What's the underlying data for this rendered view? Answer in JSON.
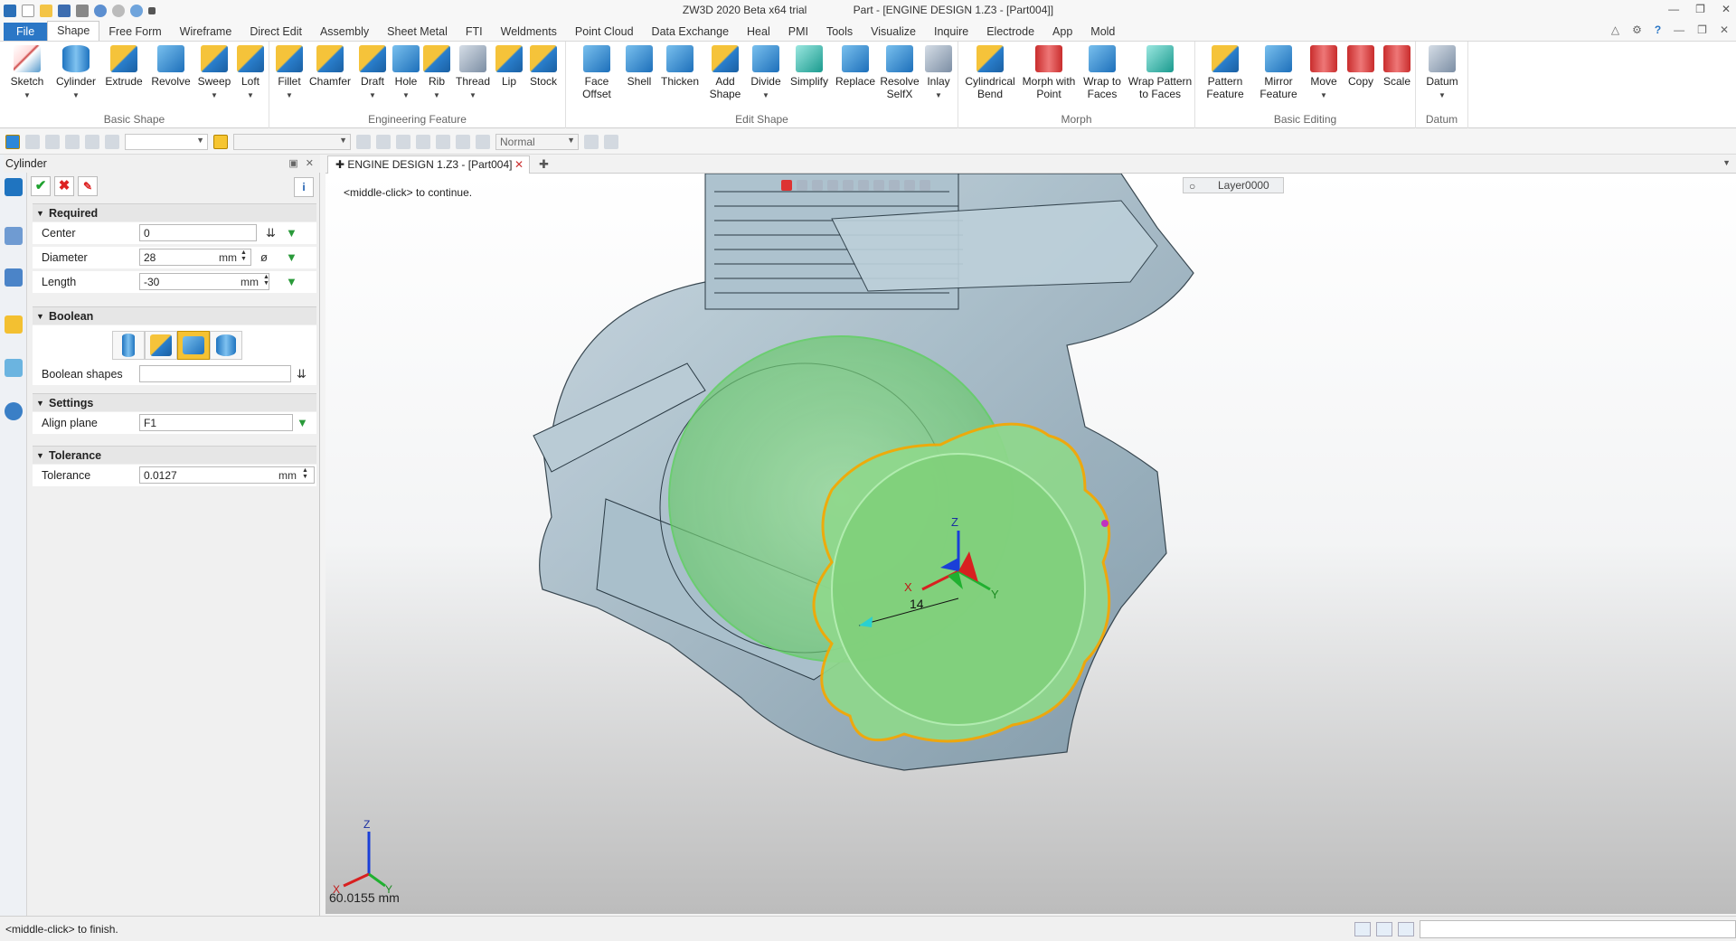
{
  "window": {
    "app_title": "ZW3D 2020 Beta x64 trial",
    "doc_title": "Part - [ENGINE DESIGN 1.Z3 - [Part004]]"
  },
  "menu": {
    "file": "File",
    "tabs": [
      "Shape",
      "Free Form",
      "Wireframe",
      "Direct Edit",
      "Assembly",
      "Sheet Metal",
      "FTI",
      "Weldments",
      "Point Cloud",
      "Data Exchange",
      "Heal",
      "PMI",
      "Tools",
      "Visualize",
      "Inquire",
      "Electrode",
      "App",
      "Mold"
    ]
  },
  "ribbon": {
    "basic_shape": {
      "label": "Basic Shape",
      "buttons": [
        "Sketch",
        "Cylinder",
        "Extrude",
        "Revolve",
        "Sweep",
        "Loft"
      ]
    },
    "engineering_feature": {
      "label": "Engineering Feature",
      "buttons": [
        "Fillet",
        "Chamfer",
        "Draft",
        "Hole",
        "Rib",
        "Thread",
        "Lip",
        "Stock"
      ]
    },
    "edit_shape": {
      "label": "Edit Shape",
      "buttons": [
        "Face Offset",
        "Shell",
        "Thicken",
        "Add Shape",
        "Divide",
        "Simplify",
        "Replace",
        "Resolve SelfX",
        "Inlay"
      ]
    },
    "morph": {
      "label": "Morph",
      "buttons": [
        "Cylindrical Bend",
        "Morph with Point",
        "Wrap to Faces",
        "Wrap Pattern to Faces"
      ]
    },
    "basic_editing": {
      "label": "Basic Editing",
      "buttons": [
        "Pattern Feature",
        "Mirror Feature",
        "Move",
        "Copy",
        "Scale"
      ]
    },
    "datum": {
      "label": "Datum",
      "buttons": [
        "Datum"
      ]
    }
  },
  "toolbar2": {
    "mode_combo": "Normal"
  },
  "panel": {
    "title": "Cylinder",
    "required": {
      "label": "Required",
      "center": {
        "label": "Center",
        "value": "0"
      },
      "diameter": {
        "label": "Diameter",
        "value": "28",
        "unit": "mm"
      },
      "length": {
        "label": "Length",
        "value": "-30",
        "unit": "mm"
      }
    },
    "boolean": {
      "label": "Boolean",
      "shapes_label": "Boolean shapes",
      "selected_index": 2
    },
    "settings": {
      "label": "Settings",
      "align_plane": {
        "label": "Align plane",
        "value": "F1"
      }
    },
    "tolerance": {
      "label": "Tolerance",
      "field": {
        "label": "Tolerance",
        "value": "0.0127",
        "unit": "mm"
      }
    }
  },
  "doc_tab": {
    "label": "ENGINE DESIGN 1.Z3 - [Part004]"
  },
  "viewport": {
    "hint": "<middle-click> to continue.",
    "layer": "Layer0000",
    "dimension": "14",
    "axis_z": "Z",
    "axis_x": "X",
    "axis_y": "Y",
    "measure": "60.0155 mm"
  },
  "status": {
    "text": "<middle-click> to finish."
  },
  "colors": {
    "accent": "#2b77c6",
    "selection": "#f5a800",
    "preview": "#7fd07a",
    "body": "#9fb5c2"
  }
}
